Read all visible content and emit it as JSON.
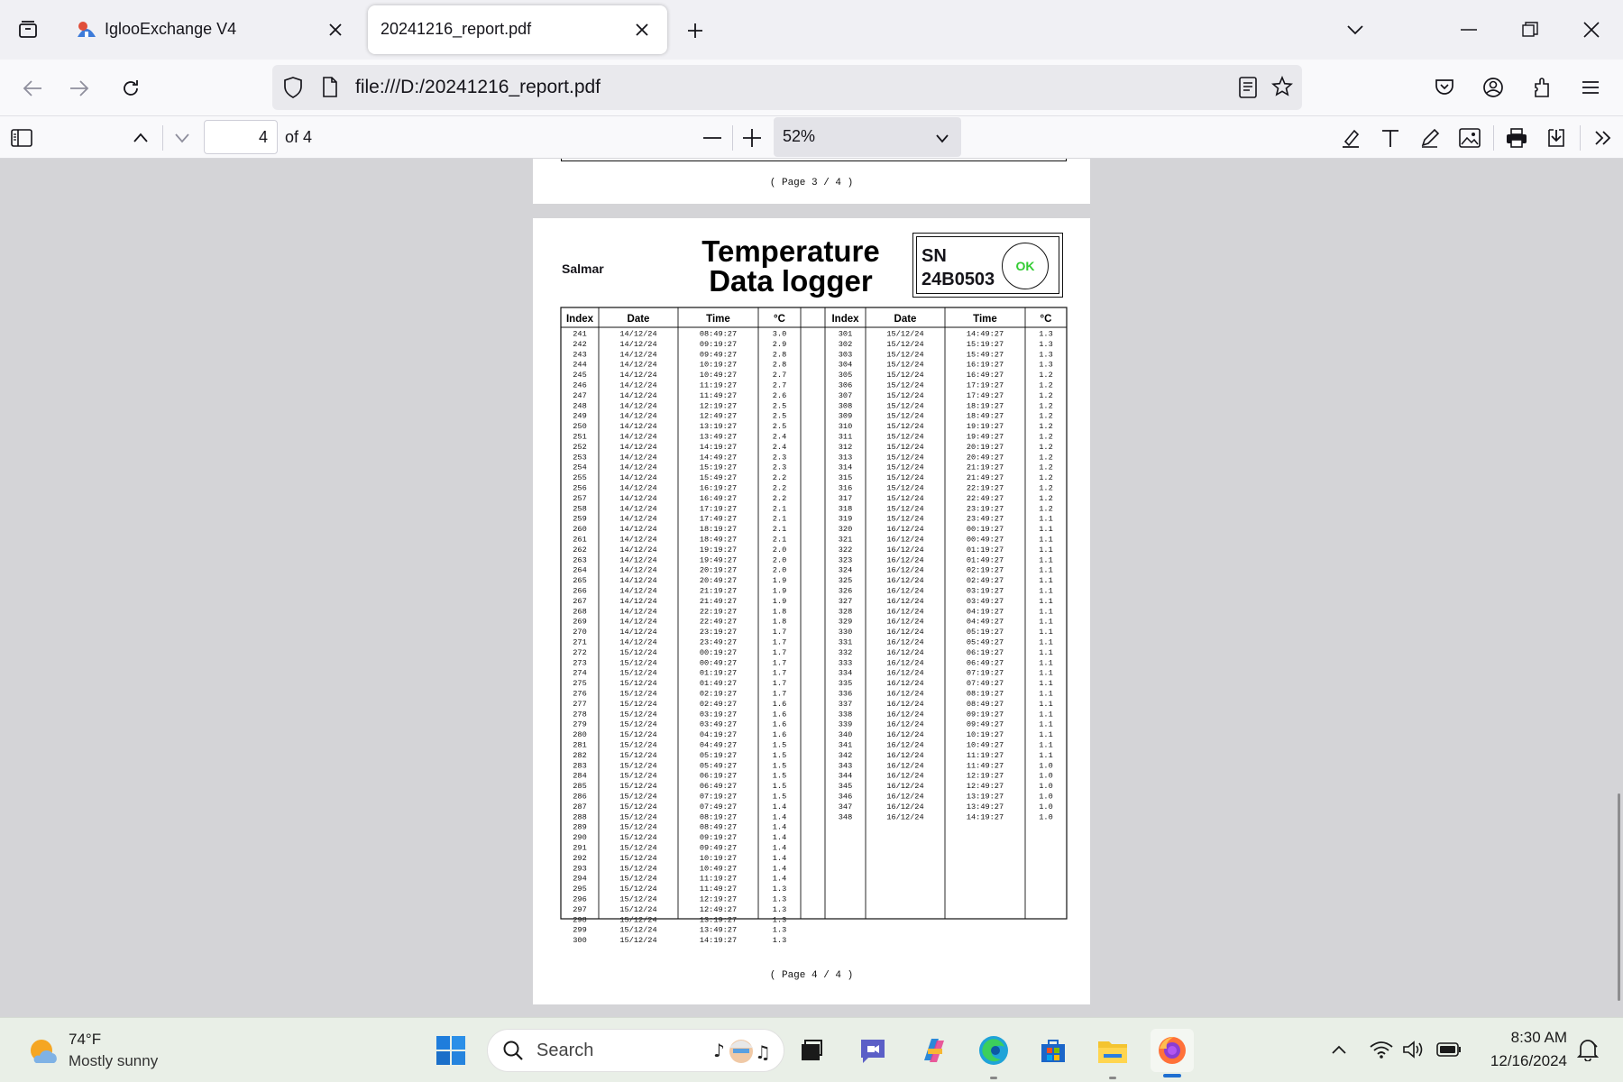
{
  "tabs": [
    {
      "title": "IglooExchange V4",
      "active": false
    },
    {
      "title": "20241216_report.pdf",
      "active": true
    }
  ],
  "nav": {
    "url": "file:///D:/20241216_report.pdf"
  },
  "pdf_toolbar": {
    "page_number": "4",
    "page_of": "of 4",
    "zoom": "52%"
  },
  "prev_page_footer": "( Page   3 / 4 )",
  "report": {
    "company": "Salmar",
    "title_line1": "Temperature",
    "title_line2": "Data logger",
    "sn_label": "SN",
    "sn_value": "24B0503",
    "status": "OK",
    "status_color": "#33cc33",
    "columns": [
      "Index",
      "Date",
      "Time",
      "°C"
    ],
    "footer": "( Page   4 / 4 )",
    "left_rows": [
      [
        "241",
        "14/12/24",
        "08:49:27",
        "3.0"
      ],
      [
        "242",
        "14/12/24",
        "09:19:27",
        "2.9"
      ],
      [
        "243",
        "14/12/24",
        "09:49:27",
        "2.8"
      ],
      [
        "244",
        "14/12/24",
        "10:19:27",
        "2.8"
      ],
      [
        "245",
        "14/12/24",
        "10:49:27",
        "2.7"
      ],
      [
        "246",
        "14/12/24",
        "11:19:27",
        "2.7"
      ],
      [
        "247",
        "14/12/24",
        "11:49:27",
        "2.6"
      ],
      [
        "248",
        "14/12/24",
        "12:19:27",
        "2.5"
      ],
      [
        "249",
        "14/12/24",
        "12:49:27",
        "2.5"
      ],
      [
        "250",
        "14/12/24",
        "13:19:27",
        "2.5"
      ],
      [
        "251",
        "14/12/24",
        "13:49:27",
        "2.4"
      ],
      [
        "252",
        "14/12/24",
        "14:19:27",
        "2.4"
      ],
      [
        "253",
        "14/12/24",
        "14:49:27",
        "2.3"
      ],
      [
        "254",
        "14/12/24",
        "15:19:27",
        "2.3"
      ],
      [
        "255",
        "14/12/24",
        "15:49:27",
        "2.2"
      ],
      [
        "256",
        "14/12/24",
        "16:19:27",
        "2.2"
      ],
      [
        "257",
        "14/12/24",
        "16:49:27",
        "2.2"
      ],
      [
        "258",
        "14/12/24",
        "17:19:27",
        "2.1"
      ],
      [
        "259",
        "14/12/24",
        "17:49:27",
        "2.1"
      ],
      [
        "260",
        "14/12/24",
        "18:19:27",
        "2.1"
      ],
      [
        "261",
        "14/12/24",
        "18:49:27",
        "2.1"
      ],
      [
        "262",
        "14/12/24",
        "19:19:27",
        "2.0"
      ],
      [
        "263",
        "14/12/24",
        "19:49:27",
        "2.0"
      ],
      [
        "264",
        "14/12/24",
        "20:19:27",
        "2.0"
      ],
      [
        "265",
        "14/12/24",
        "20:49:27",
        "1.9"
      ],
      [
        "266",
        "14/12/24",
        "21:19:27",
        "1.9"
      ],
      [
        "267",
        "14/12/24",
        "21:49:27",
        "1.9"
      ],
      [
        "268",
        "14/12/24",
        "22:19:27",
        "1.8"
      ],
      [
        "269",
        "14/12/24",
        "22:49:27",
        "1.8"
      ],
      [
        "270",
        "14/12/24",
        "23:19:27",
        "1.7"
      ],
      [
        "271",
        "14/12/24",
        "23:49:27",
        "1.7"
      ],
      [
        "272",
        "15/12/24",
        "00:19:27",
        "1.7"
      ],
      [
        "273",
        "15/12/24",
        "00:49:27",
        "1.7"
      ],
      [
        "274",
        "15/12/24",
        "01:19:27",
        "1.7"
      ],
      [
        "275",
        "15/12/24",
        "01:49:27",
        "1.7"
      ],
      [
        "276",
        "15/12/24",
        "02:19:27",
        "1.7"
      ],
      [
        "277",
        "15/12/24",
        "02:49:27",
        "1.6"
      ],
      [
        "278",
        "15/12/24",
        "03:19:27",
        "1.6"
      ],
      [
        "279",
        "15/12/24",
        "03:49:27",
        "1.6"
      ],
      [
        "280",
        "15/12/24",
        "04:19:27",
        "1.6"
      ],
      [
        "281",
        "15/12/24",
        "04:49:27",
        "1.5"
      ],
      [
        "282",
        "15/12/24",
        "05:19:27",
        "1.5"
      ],
      [
        "283",
        "15/12/24",
        "05:49:27",
        "1.5"
      ],
      [
        "284",
        "15/12/24",
        "06:19:27",
        "1.5"
      ],
      [
        "285",
        "15/12/24",
        "06:49:27",
        "1.5"
      ],
      [
        "286",
        "15/12/24",
        "07:19:27",
        "1.5"
      ],
      [
        "287",
        "15/12/24",
        "07:49:27",
        "1.4"
      ],
      [
        "288",
        "15/12/24",
        "08:19:27",
        "1.4"
      ],
      [
        "289",
        "15/12/24",
        "08:49:27",
        "1.4"
      ],
      [
        "290",
        "15/12/24",
        "09:19:27",
        "1.4"
      ],
      [
        "291",
        "15/12/24",
        "09:49:27",
        "1.4"
      ],
      [
        "292",
        "15/12/24",
        "10:19:27",
        "1.4"
      ],
      [
        "293",
        "15/12/24",
        "10:49:27",
        "1.4"
      ],
      [
        "294",
        "15/12/24",
        "11:19:27",
        "1.4"
      ],
      [
        "295",
        "15/12/24",
        "11:49:27",
        "1.3"
      ],
      [
        "296",
        "15/12/24",
        "12:19:27",
        "1.3"
      ],
      [
        "297",
        "15/12/24",
        "12:49:27",
        "1.3"
      ],
      [
        "298",
        "15/12/24",
        "13:19:27",
        "1.3"
      ],
      [
        "299",
        "15/12/24",
        "13:49:27",
        "1.3"
      ],
      [
        "300",
        "15/12/24",
        "14:19:27",
        "1.3"
      ]
    ],
    "right_rows": [
      [
        "301",
        "15/12/24",
        "14:49:27",
        "1.3"
      ],
      [
        "302",
        "15/12/24",
        "15:19:27",
        "1.3"
      ],
      [
        "303",
        "15/12/24",
        "15:49:27",
        "1.3"
      ],
      [
        "304",
        "15/12/24",
        "16:19:27",
        "1.3"
      ],
      [
        "305",
        "15/12/24",
        "16:49:27",
        "1.2"
      ],
      [
        "306",
        "15/12/24",
        "17:19:27",
        "1.2"
      ],
      [
        "307",
        "15/12/24",
        "17:49:27",
        "1.2"
      ],
      [
        "308",
        "15/12/24",
        "18:19:27",
        "1.2"
      ],
      [
        "309",
        "15/12/24",
        "18:49:27",
        "1.2"
      ],
      [
        "310",
        "15/12/24",
        "19:19:27",
        "1.2"
      ],
      [
        "311",
        "15/12/24",
        "19:49:27",
        "1.2"
      ],
      [
        "312",
        "15/12/24",
        "20:19:27",
        "1.2"
      ],
      [
        "313",
        "15/12/24",
        "20:49:27",
        "1.2"
      ],
      [
        "314",
        "15/12/24",
        "21:19:27",
        "1.2"
      ],
      [
        "315",
        "15/12/24",
        "21:49:27",
        "1.2"
      ],
      [
        "316",
        "15/12/24",
        "22:19:27",
        "1.2"
      ],
      [
        "317",
        "15/12/24",
        "22:49:27",
        "1.2"
      ],
      [
        "318",
        "15/12/24",
        "23:19:27",
        "1.2"
      ],
      [
        "319",
        "15/12/24",
        "23:49:27",
        "1.1"
      ],
      [
        "320",
        "16/12/24",
        "00:19:27",
        "1.1"
      ],
      [
        "321",
        "16/12/24",
        "00:49:27",
        "1.1"
      ],
      [
        "322",
        "16/12/24",
        "01:19:27",
        "1.1"
      ],
      [
        "323",
        "16/12/24",
        "01:49:27",
        "1.1"
      ],
      [
        "324",
        "16/12/24",
        "02:19:27",
        "1.1"
      ],
      [
        "325",
        "16/12/24",
        "02:49:27",
        "1.1"
      ],
      [
        "326",
        "16/12/24",
        "03:19:27",
        "1.1"
      ],
      [
        "327",
        "16/12/24",
        "03:49:27",
        "1.1"
      ],
      [
        "328",
        "16/12/24",
        "04:19:27",
        "1.1"
      ],
      [
        "329",
        "16/12/24",
        "04:49:27",
        "1.1"
      ],
      [
        "330",
        "16/12/24",
        "05:19:27",
        "1.1"
      ],
      [
        "331",
        "16/12/24",
        "05:49:27",
        "1.1"
      ],
      [
        "332",
        "16/12/24",
        "06:19:27",
        "1.1"
      ],
      [
        "333",
        "16/12/24",
        "06:49:27",
        "1.1"
      ],
      [
        "334",
        "16/12/24",
        "07:19:27",
        "1.1"
      ],
      [
        "335",
        "16/12/24",
        "07:49:27",
        "1.1"
      ],
      [
        "336",
        "16/12/24",
        "08:19:27",
        "1.1"
      ],
      [
        "337",
        "16/12/24",
        "08:49:27",
        "1.1"
      ],
      [
        "338",
        "16/12/24",
        "09:19:27",
        "1.1"
      ],
      [
        "339",
        "16/12/24",
        "09:49:27",
        "1.1"
      ],
      [
        "340",
        "16/12/24",
        "10:19:27",
        "1.1"
      ],
      [
        "341",
        "16/12/24",
        "10:49:27",
        "1.1"
      ],
      [
        "342",
        "16/12/24",
        "11:19:27",
        "1.1"
      ],
      [
        "343",
        "16/12/24",
        "11:49:27",
        "1.0"
      ],
      [
        "344",
        "16/12/24",
        "12:19:27",
        "1.0"
      ],
      [
        "345",
        "16/12/24",
        "12:49:27",
        "1.0"
      ],
      [
        "346",
        "16/12/24",
        "13:19:27",
        "1.0"
      ],
      [
        "347",
        "16/12/24",
        "13:49:27",
        "1.0"
      ],
      [
        "348",
        "16/12/24",
        "14:19:27",
        "1.0"
      ]
    ]
  },
  "taskbar": {
    "weather_temp": "74°F",
    "weather_desc": "Mostly sunny",
    "search_placeholder": "Search",
    "time": "8:30 AM",
    "date": "12/16/2024"
  }
}
